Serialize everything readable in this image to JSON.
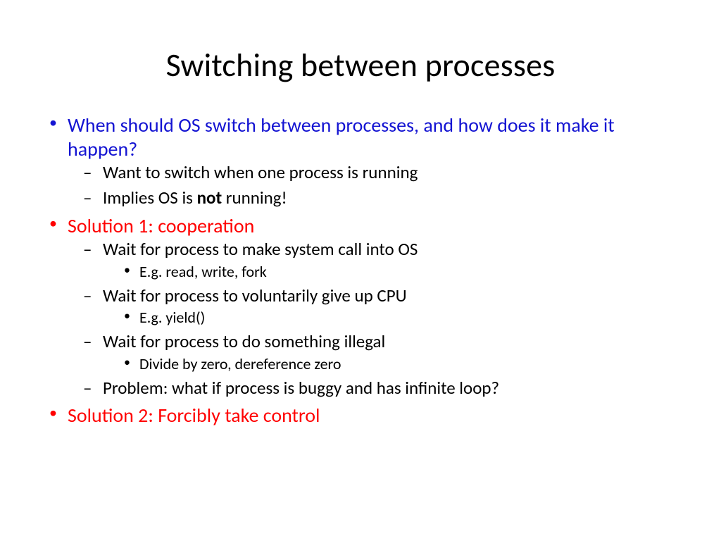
{
  "title": "Switching between processes",
  "bullets": {
    "b1": "When should OS switch between processes, and how does it make it happen?",
    "b1_1": "Want to switch when one process is running",
    "b1_2_pre": "Implies OS is ",
    "b1_2_bold": "not",
    "b1_2_post": " running!",
    "b2": "Solution 1: cooperation",
    "b2_1": "Wait for process to make system call into OS",
    "b2_1_1": "E.g. read, write, fork",
    "b2_2": "Wait for process to voluntarily give up CPU",
    "b2_2_1": "E.g. yield()",
    "b2_3": "Wait for process to do something illegal",
    "b2_3_1": "Divide by zero, dereference zero",
    "b2_4": "Problem: what if process is buggy and has infinite loop?",
    "b3": "Solution 2: Forcibly take control"
  }
}
